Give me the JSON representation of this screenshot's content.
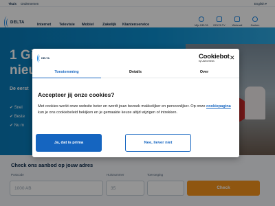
{
  "topbar": {
    "segments": [
      "Thuis",
      "Ondernemen"
    ],
    "language": "English ▾"
  },
  "header": {
    "logo_text": "DELTA",
    "nav": [
      "Internet",
      "Televisie",
      "Mobiel",
      "Zakelijk",
      "Klantenservice"
    ],
    "utility": [
      {
        "label": "Mijn DELTA",
        "icon": "user-icon"
      },
      {
        "label": "DELTA TV",
        "icon": "tv-icon"
      },
      {
        "label": "Webmail",
        "icon": "mail-icon"
      },
      {
        "label": "Zoeken",
        "icon": "search-icon"
      }
    ]
  },
  "hero": {
    "title": "1 Gi nieu",
    "subtitle": "De eerst",
    "bullets": [
      "Snel",
      "Beste",
      "Nu m"
    ]
  },
  "address_check": {
    "title": "Check ons aanbod op jouw adres",
    "postcode_label": "Postcode",
    "postcode_placeholder": "1000 AB",
    "house_number_label": "Huisnummer",
    "house_number_placeholder": "35",
    "addition_label": "Toevoeging",
    "button": "Check"
  },
  "cookie_dialog": {
    "logo_text": "DELTA",
    "brand": "Cookiebot",
    "brand_sub": "by Usercentrics",
    "tabs": [
      "Toestemming",
      "Details",
      "Over"
    ],
    "active_tab": "Toestemming",
    "heading": "Accepteer jij onze cookies?",
    "body_before": "Met cookies werkt onze website beter en wordt jouw bezoek makkelijker en persoonlijker. Op onze ",
    "body_link": "cookiepagina",
    "body_after": " kun je ons cookiebeleid bekijken en je gemaakte keuze altijd wijzigen of intrekken.",
    "accept_label": "Ja, dat is prima",
    "decline_label": "Nee, liever niet",
    "close_symbol": "✕"
  },
  "colors": {
    "brand_blue": "#1565c0",
    "hero_blue": "#0b8fd0",
    "cta_orange": "#f7941d",
    "overlay": "rgba(0,0,0,0.42)"
  }
}
